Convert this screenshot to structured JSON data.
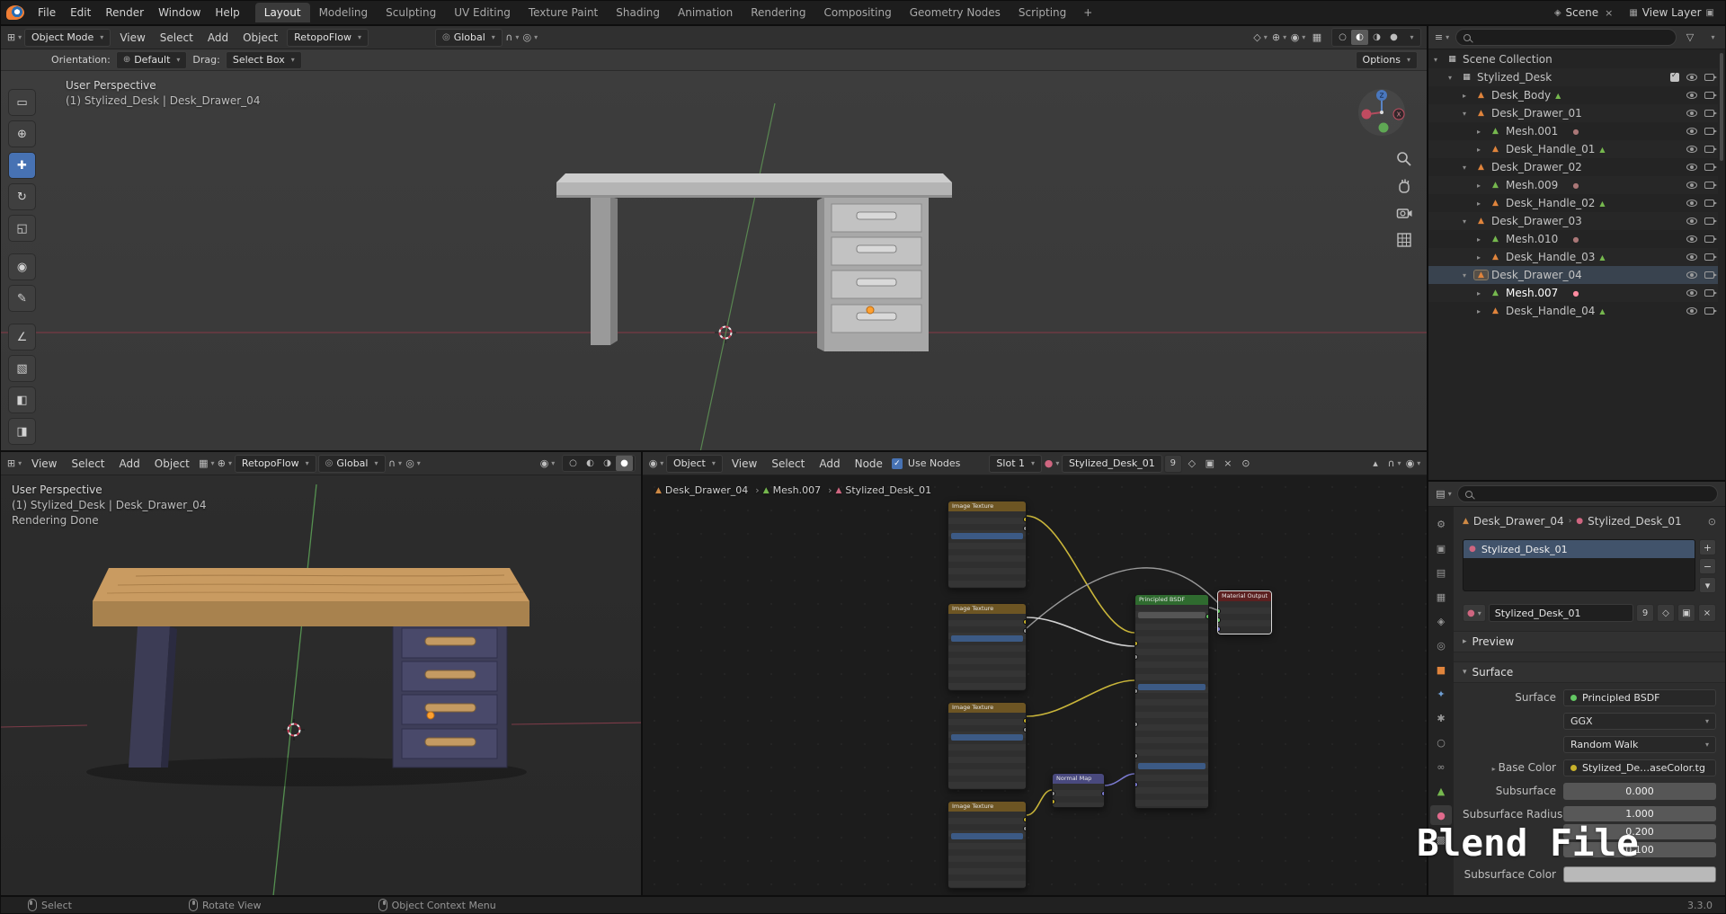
{
  "topbar": {
    "menus": [
      {
        "label": "File"
      },
      {
        "label": "Edit"
      },
      {
        "label": "Render"
      },
      {
        "label": "Window"
      },
      {
        "label": "Help"
      }
    ],
    "tabs": [
      {
        "label": "Layout",
        "active": true
      },
      {
        "label": "Modeling"
      },
      {
        "label": "Sculpting"
      },
      {
        "label": "UV Editing"
      },
      {
        "label": "Texture Paint"
      },
      {
        "label": "Shading"
      },
      {
        "label": "Animation"
      },
      {
        "label": "Rendering"
      },
      {
        "label": "Compositing"
      },
      {
        "label": "Geometry Nodes"
      },
      {
        "label": "Scripting"
      }
    ],
    "add_tab": "+",
    "scene": "Scene",
    "scene_close": "×",
    "view_layer": "View Layer"
  },
  "viewport_main": {
    "mode": "Object Mode",
    "menus": [
      {
        "label": "View"
      },
      {
        "label": "Select"
      },
      {
        "label": "Add"
      },
      {
        "label": "Object"
      }
    ],
    "retopoflow": "RetopoFlow",
    "orientation_dd": "Global",
    "tools": [
      {
        "glyph": "▭",
        "name": "select-box-tool"
      },
      {
        "glyph": "⊕",
        "name": "cursor-tool"
      },
      {
        "glyph": "✚",
        "name": "move-tool",
        "active": true
      },
      {
        "glyph": "↻",
        "name": "rotate-tool"
      },
      {
        "glyph": "◱",
        "name": "scale-tool"
      },
      {
        "glyph": "◉",
        "name": "transform-tool"
      },
      {
        "glyph": "✎",
        "name": "annotate-tool"
      },
      {
        "glyph": "∠",
        "name": "measure-tool"
      },
      {
        "glyph": "▧",
        "name": "add-cube-tool"
      },
      {
        "glyph": "◧",
        "name": "retopoflow-tool-1"
      },
      {
        "glyph": "◨",
        "name": "retopoflow-tool-2"
      }
    ],
    "tool_settings": {
      "orientation_label": "Orientation:",
      "orientation_value": "Default",
      "drag_label": "Drag:",
      "drag_value": "Select Box",
      "options": "Options"
    },
    "overlay_line1": "User Perspective",
    "overlay_line2": "(1) Stylized_Desk | Desk_Drawer_04",
    "gizmo_z": "Z",
    "gizmo_x": "X"
  },
  "viewport_render": {
    "menus": [
      {
        "label": "View"
      },
      {
        "label": "Select"
      },
      {
        "label": "Add"
      },
      {
        "label": "Object"
      }
    ],
    "retopoflow": "RetopoFlow",
    "orientation_dd": "Global",
    "overlay_line1": "User Perspective",
    "overlay_line2": "(1) Stylized_Desk | Desk_Drawer_04",
    "overlay_line3": "Rendering Done"
  },
  "shader": {
    "object_dd": "Object",
    "menus": [
      {
        "label": "View"
      },
      {
        "label": "Select"
      },
      {
        "label": "Add"
      },
      {
        "label": "Node"
      }
    ],
    "use_nodes": "Use Nodes",
    "slot": "Slot 1",
    "material": "Stylized_Desk_01",
    "users": "9",
    "breadcrumb": [
      {
        "label": "Desk_Drawer_04",
        "icon": "object"
      },
      {
        "label": "Mesh.007",
        "icon": "mesh"
      },
      {
        "label": "Stylized_Desk_01",
        "icon": "material"
      }
    ],
    "nodes": {
      "tex1": {
        "title": "Image Texture"
      },
      "tex2": {
        "title": "Image Texture"
      },
      "tex3": {
        "title": "Image Texture"
      },
      "tex4": {
        "title": "Image Texture"
      },
      "normal": {
        "title": "Normal Map"
      },
      "bsdf": {
        "title": "Principled BSDF"
      },
      "output": {
        "title": "Material Output"
      }
    }
  },
  "outliner": {
    "search_value": "",
    "rows": [
      {
        "label": "Scene Collection",
        "depth": 0,
        "icon": "collection",
        "caret": "▾",
        "eye": false,
        "camera": false,
        "checkbox": false
      },
      {
        "label": "Stylized_Desk",
        "depth": 1,
        "icon": "collection",
        "caret": "▾",
        "eye": true,
        "camera": true,
        "checkbox": true
      },
      {
        "label": "Desk_Body",
        "depth": 2,
        "icon": "object",
        "caret": "▸",
        "eye": true,
        "camera": true,
        "badge_mesh": true
      },
      {
        "label": "Desk_Drawer_01",
        "depth": 2,
        "icon": "object",
        "caret": "▾",
        "eye": true,
        "camera": true
      },
      {
        "label": "Mesh.001",
        "depth": 3,
        "icon": "mesh",
        "caret": "▸",
        "eye": true,
        "camera": true,
        "badge_mat": true
      },
      {
        "label": "Desk_Handle_01",
        "depth": 3,
        "icon": "object",
        "caret": "▸",
        "eye": true,
        "camera": true,
        "badge_mesh": true
      },
      {
        "label": "Desk_Drawer_02",
        "depth": 2,
        "icon": "object",
        "caret": "▾",
        "eye": true,
        "camera": true
      },
      {
        "label": "Mesh.009",
        "depth": 3,
        "icon": "mesh",
        "caret": "▸",
        "eye": true,
        "camera": true,
        "badge_mat": true
      },
      {
        "label": "Desk_Handle_02",
        "depth": 3,
        "icon": "object",
        "caret": "▸",
        "eye": true,
        "camera": true,
        "badge_mesh": true
      },
      {
        "label": "Desk_Drawer_03",
        "depth": 2,
        "icon": "object",
        "caret": "▾",
        "eye": true,
        "camera": true
      },
      {
        "label": "Mesh.010",
        "depth": 3,
        "icon": "mesh",
        "caret": "▸",
        "eye": true,
        "camera": true,
        "badge_mat": true
      },
      {
        "label": "Desk_Handle_03",
        "depth": 3,
        "icon": "object",
        "caret": "▸",
        "eye": true,
        "camera": true,
        "badge_mesh": true
      },
      {
        "label": "Desk_Drawer_04",
        "depth": 2,
        "icon": "object",
        "caret": "▾",
        "eye": true,
        "camera": true,
        "selected": true
      },
      {
        "label": "Mesh.007",
        "depth": 3,
        "icon": "mesh",
        "caret": "▸",
        "eye": true,
        "camera": true,
        "badge_mat": true,
        "mat_active": true,
        "active": true
      },
      {
        "label": "Desk_Handle_04",
        "depth": 3,
        "icon": "object",
        "caret": "▸",
        "eye": true,
        "camera": true,
        "badge_mesh": true
      }
    ]
  },
  "properties": {
    "tabs": [
      {
        "glyph": "⚙",
        "name": "tool"
      },
      {
        "glyph": "▣",
        "name": "render"
      },
      {
        "glyph": "▤",
        "name": "output"
      },
      {
        "glyph": "▦",
        "name": "view-layer"
      },
      {
        "glyph": "◈",
        "name": "scene"
      },
      {
        "glyph": "◎",
        "name": "world"
      },
      {
        "glyph": "■",
        "name": "object"
      },
      {
        "glyph": "✦",
        "name": "modifiers"
      },
      {
        "glyph": "✱",
        "name": "particles"
      },
      {
        "glyph": "○",
        "name": "physics"
      },
      {
        "glyph": "∞",
        "name": "constraints"
      },
      {
        "glyph": "▲",
        "name": "object-data"
      },
      {
        "glyph": "●",
        "name": "material",
        "active": true
      },
      {
        "glyph": "▩",
        "name": "texture"
      }
    ],
    "breadcrumb_object": "Desk_Drawer_04",
    "breadcrumb_material": "Stylized_Desk_01",
    "slot_name": "Stylized_Desk_01",
    "slot_add": "+",
    "slot_remove": "−",
    "slot_specials": "▾",
    "name_value": "Stylized_Desk_01",
    "users": "9",
    "shield": "◇",
    "duplicate": "▣",
    "close": "×",
    "preview_section": "Preview",
    "surface_section": "Surface",
    "surface_label": "Surface",
    "surface_value": "Principled BSDF",
    "distribution_value": "GGX",
    "subsurface_method_value": "Random Walk",
    "base_color_label": "Base Color",
    "base_color_value": "Stylized_De…aseColor.tg",
    "subsurface_label": "Subsurface",
    "subsurface_value": "0.000",
    "radius_label": "Subsurface Radius",
    "radius_values": [
      {
        "v": "1.000"
      },
      {
        "v": "0.200"
      },
      {
        "v": "0.100"
      }
    ],
    "subsurface_color_label": "Subsurface Color"
  },
  "statusbar": {
    "items": [
      {
        "icon": "left",
        "label": "Select"
      },
      {
        "icon": "middle",
        "label": "Rotate View"
      },
      {
        "icon": "right",
        "label": "Object Context Menu"
      }
    ],
    "version": "3.3.0"
  },
  "watermark": "Blend File"
}
